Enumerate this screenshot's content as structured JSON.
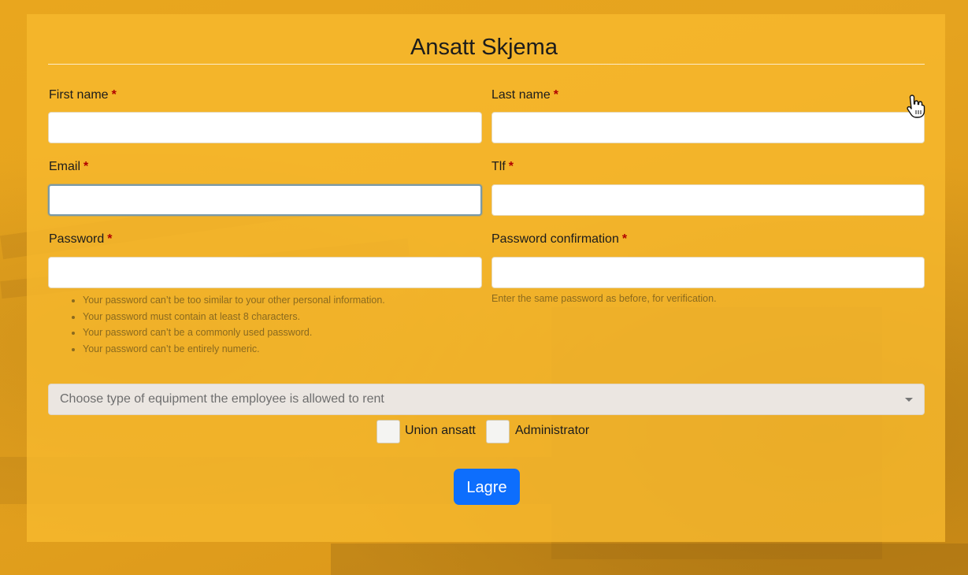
{
  "form": {
    "title": "Ansatt Skjema",
    "required_marker": "*",
    "fields": {
      "first_name": {
        "label": "First name",
        "value": ""
      },
      "last_name": {
        "label": "Last name",
        "value": ""
      },
      "email": {
        "label": "Email",
        "value": ""
      },
      "tlf": {
        "label": "Tlf",
        "value": ""
      },
      "password": {
        "label": "Password",
        "value": ""
      },
      "password_confirmation": {
        "label": "Password confirmation",
        "value": ""
      }
    },
    "password_help": [
      "Your password can’t be too similar to your other personal information.",
      "Your password must contain at least 8 characters.",
      "Your password can’t be a commonly used password.",
      "Your password can’t be entirely numeric."
    ],
    "password_confirmation_help": "Enter the same password as before, for verification.",
    "equipment_select": {
      "placeholder": "Choose type of equipment the employee is allowed to rent"
    },
    "checkboxes": {
      "union": {
        "label": "Union ansatt",
        "checked": false
      },
      "admin": {
        "label": "Administrator",
        "checked": false
      }
    },
    "submit_label": "Lagre"
  },
  "colors": {
    "background": "#e9a61e",
    "panel": "#f6b82d",
    "button": "#0d6efd",
    "required": "#b00000"
  },
  "icons": {
    "cursor": "hand-pointer-icon",
    "select_caret": "caret-down-icon"
  }
}
